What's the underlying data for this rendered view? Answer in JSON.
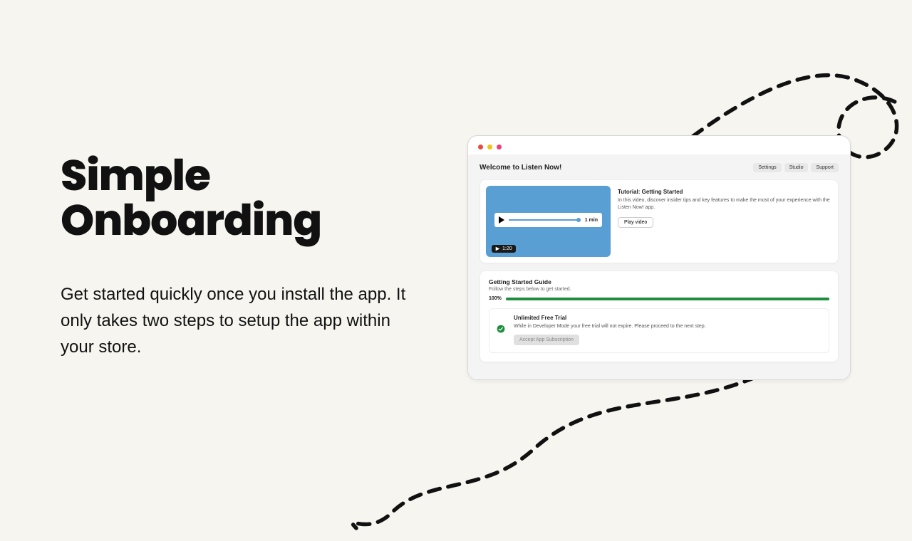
{
  "hero": {
    "title_line1": "Simple",
    "title_line2": "Onboarding",
    "description": "Get started quickly once you install the app. It only takes two steps to setup the app within your store."
  },
  "app": {
    "welcome": "Welcome to Listen Now!",
    "header_buttons": {
      "settings": "Settings",
      "studio": "Studio",
      "support": "Support"
    },
    "tutorial": {
      "title": "Tutorial: Getting Started",
      "description": "In this video, discover insider tips and key features to make the most of your experience with the Listen Now! app.",
      "play_label": "Play video",
      "video_badge": "1:20",
      "video_duration_label": "1 min"
    },
    "guide": {
      "title": "Getting Started Guide",
      "subtitle": "Follow the steps below to get started.",
      "percent": "100%",
      "step": {
        "title": "Unlimited Free Trial",
        "description": "While in Developer Mode your free trial will not expire. Please proceed to the next step.",
        "button": "Accept App Subscription"
      }
    }
  }
}
